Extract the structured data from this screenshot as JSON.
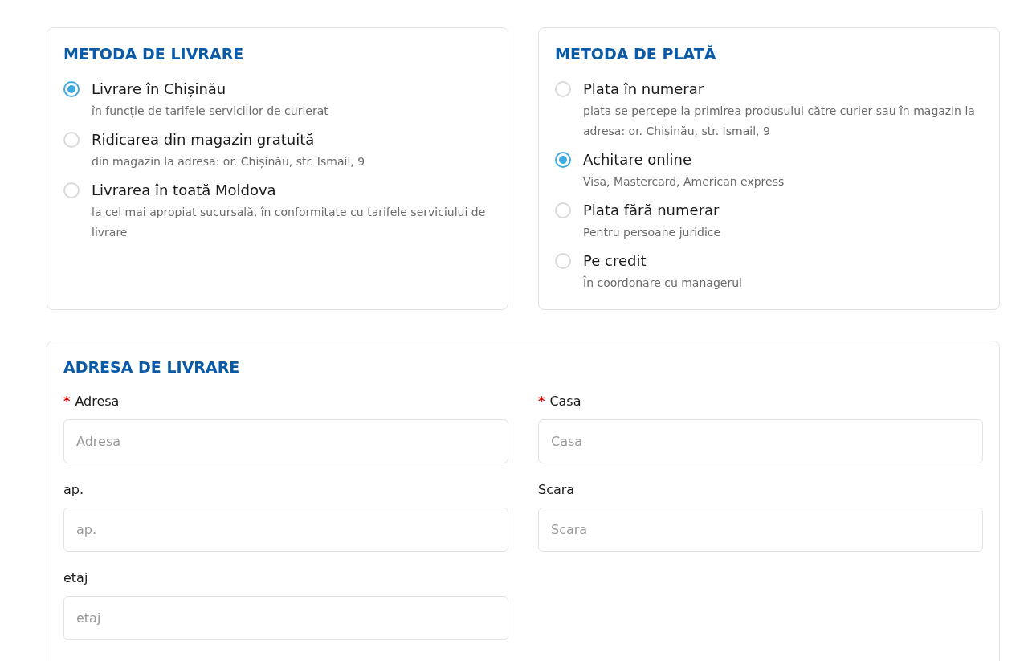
{
  "delivery": {
    "title": "METODA DE LIVRARE",
    "options": [
      {
        "label": "Livrare în Chișinău",
        "description": "în funcție de tarifele serviciilor de curierat",
        "selected": true
      },
      {
        "label": "Ridicarea din magazin gratuită",
        "description": "din magazin la adresa: or. Chișinău, str. Ismail, 9",
        "selected": false
      },
      {
        "label": "Livrarea în toată Moldova",
        "description": "la cel mai apropiat sucursală, în conformitate cu tarifele serviciului de livrare",
        "selected": false
      }
    ]
  },
  "payment": {
    "title": "METODA DE PLATĂ",
    "options": [
      {
        "label": "Plata în numerar",
        "description": "plata se percepe la primirea produsului către curier sau în magazin la adresa: or. Chișinău, str. Ismail, 9",
        "selected": false
      },
      {
        "label": "Achitare online",
        "description": "Visa, Mastercard, American express",
        "selected": true
      },
      {
        "label": "Plata fără numerar",
        "description": "Pentru persoane juridice",
        "selected": false
      },
      {
        "label": "Pe credit",
        "description": "În coordonare cu managerul",
        "selected": false
      }
    ]
  },
  "address": {
    "title": "ADRESA DE LIVRARE",
    "required_mark": "*",
    "fields": [
      {
        "label": "Adresa",
        "placeholder": "Adresa",
        "required": true
      },
      {
        "label": "Casa",
        "placeholder": "Casa",
        "required": true
      },
      {
        "label": "ap.",
        "placeholder": "ap.",
        "required": false
      },
      {
        "label": "Scara",
        "placeholder": "Scara",
        "required": false
      },
      {
        "label": "etaj",
        "placeholder": "etaj",
        "required": false
      }
    ]
  }
}
